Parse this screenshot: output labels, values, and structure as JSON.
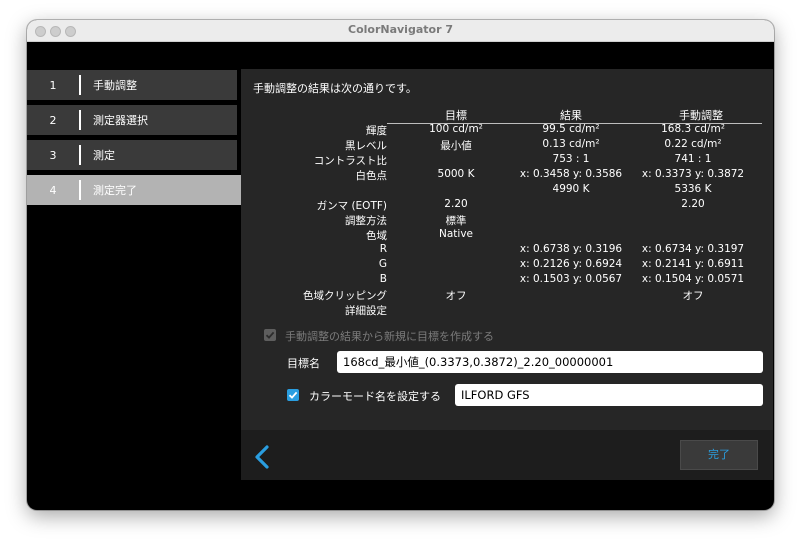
{
  "window": {
    "title": "ColorNavigator 7"
  },
  "sidebar": {
    "steps": [
      {
        "num": "1",
        "label": "手動調整"
      },
      {
        "num": "2",
        "label": "測定器選択"
      },
      {
        "num": "3",
        "label": "測定"
      },
      {
        "num": "4",
        "label": "測定完了"
      }
    ],
    "active_step": 4
  },
  "main": {
    "intro": "手動調整の結果は次の通りです。",
    "columns": {
      "target": "目標",
      "result": "結果",
      "manual": "手動調整"
    },
    "rows": {
      "luminance": {
        "label": "輝度",
        "target": "100 cd/m²",
        "result": "99.5 cd/m²",
        "manual": "168.3 cd/m²"
      },
      "black_level": {
        "label": "黒レベル",
        "target": "最小値",
        "result": "0.13 cd/m²",
        "manual": "0.22 cd/m²"
      },
      "contrast": {
        "label": "コントラスト比",
        "target": "",
        "result": "753 : 1",
        "manual": "741 : 1"
      },
      "white_point": {
        "label": "白色点",
        "target": "5000 K",
        "result": "x: 0.3458  y: 0.3586",
        "manual": "x: 0.3373  y: 0.3872",
        "result_cct": "4990 K",
        "manual_cct": "5336 K"
      },
      "gamma": {
        "label": "ガンマ (EOTF)",
        "target": "2.20",
        "result": "",
        "manual": "2.20"
      },
      "method": {
        "label": "調整方法",
        "target": "標準",
        "result": "",
        "manual": ""
      },
      "gamut": {
        "label": "色域",
        "target": "Native",
        "result": "",
        "manual": ""
      },
      "r": {
        "label": "R",
        "target": "",
        "result": "x: 0.6738  y: 0.3196",
        "manual": "x: 0.6734  y: 0.3197"
      },
      "g": {
        "label": "G",
        "target": "",
        "result": "x: 0.2126  y: 0.6924",
        "manual": "x: 0.2141  y: 0.6911"
      },
      "b": {
        "label": "B",
        "target": "",
        "result": "x: 0.1503  y: 0.0567",
        "manual": "x: 0.1504  y: 0.0571"
      },
      "clipping": {
        "label": "色域クリッピング",
        "target": "オフ",
        "result": "",
        "manual": "オフ"
      },
      "details": {
        "label": "詳細設定",
        "target": "",
        "result": "",
        "manual": ""
      }
    },
    "create_target": {
      "label": "手動調整の結果から新規に目標を作成する",
      "checked": true,
      "disabled": true
    },
    "target_name": {
      "label": "目標名",
      "value": "168cd_最小値_(0.3373,0.3872)_2.20_00000001"
    },
    "color_mode": {
      "label": "カラーモード名を設定する",
      "checked": true,
      "value": "ILFORD GFS"
    }
  },
  "footer": {
    "back_icon": "chevron-left-icon",
    "done_label": "完了"
  },
  "colors": {
    "accent": "#2a9ee0",
    "panel": "#262626",
    "sidebar_item": "#3a3a3a",
    "sidebar_active": "#b3b3b3"
  }
}
